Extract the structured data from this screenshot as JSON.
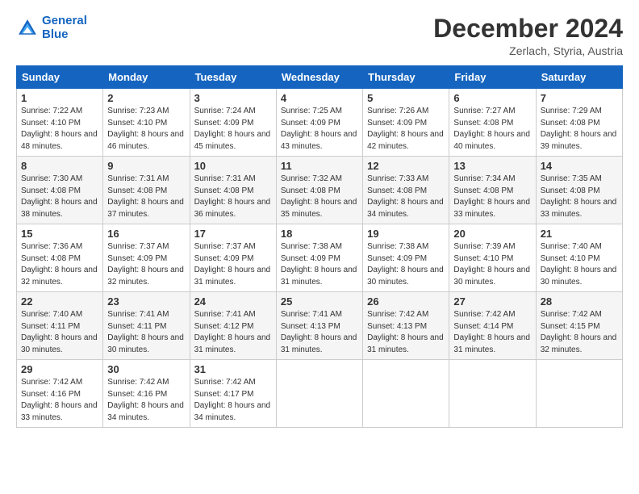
{
  "header": {
    "logo_line1": "General",
    "logo_line2": "Blue",
    "month_title": "December 2024",
    "location": "Zerlach, Styria, Austria"
  },
  "weekdays": [
    "Sunday",
    "Monday",
    "Tuesday",
    "Wednesday",
    "Thursday",
    "Friday",
    "Saturday"
  ],
  "rows": [
    [
      {
        "day": "1",
        "sunrise": "Sunrise: 7:22 AM",
        "sunset": "Sunset: 4:10 PM",
        "daylight": "Daylight: 8 hours and 48 minutes."
      },
      {
        "day": "2",
        "sunrise": "Sunrise: 7:23 AM",
        "sunset": "Sunset: 4:10 PM",
        "daylight": "Daylight: 8 hours and 46 minutes."
      },
      {
        "day": "3",
        "sunrise": "Sunrise: 7:24 AM",
        "sunset": "Sunset: 4:09 PM",
        "daylight": "Daylight: 8 hours and 45 minutes."
      },
      {
        "day": "4",
        "sunrise": "Sunrise: 7:25 AM",
        "sunset": "Sunset: 4:09 PM",
        "daylight": "Daylight: 8 hours and 43 minutes."
      },
      {
        "day": "5",
        "sunrise": "Sunrise: 7:26 AM",
        "sunset": "Sunset: 4:09 PM",
        "daylight": "Daylight: 8 hours and 42 minutes."
      },
      {
        "day": "6",
        "sunrise": "Sunrise: 7:27 AM",
        "sunset": "Sunset: 4:08 PM",
        "daylight": "Daylight: 8 hours and 40 minutes."
      },
      {
        "day": "7",
        "sunrise": "Sunrise: 7:29 AM",
        "sunset": "Sunset: 4:08 PM",
        "daylight": "Daylight: 8 hours and 39 minutes."
      }
    ],
    [
      {
        "day": "8",
        "sunrise": "Sunrise: 7:30 AM",
        "sunset": "Sunset: 4:08 PM",
        "daylight": "Daylight: 8 hours and 38 minutes."
      },
      {
        "day": "9",
        "sunrise": "Sunrise: 7:31 AM",
        "sunset": "Sunset: 4:08 PM",
        "daylight": "Daylight: 8 hours and 37 minutes."
      },
      {
        "day": "10",
        "sunrise": "Sunrise: 7:31 AM",
        "sunset": "Sunset: 4:08 PM",
        "daylight": "Daylight: 8 hours and 36 minutes."
      },
      {
        "day": "11",
        "sunrise": "Sunrise: 7:32 AM",
        "sunset": "Sunset: 4:08 PM",
        "daylight": "Daylight: 8 hours and 35 minutes."
      },
      {
        "day": "12",
        "sunrise": "Sunrise: 7:33 AM",
        "sunset": "Sunset: 4:08 PM",
        "daylight": "Daylight: 8 hours and 34 minutes."
      },
      {
        "day": "13",
        "sunrise": "Sunrise: 7:34 AM",
        "sunset": "Sunset: 4:08 PM",
        "daylight": "Daylight: 8 hours and 33 minutes."
      },
      {
        "day": "14",
        "sunrise": "Sunrise: 7:35 AM",
        "sunset": "Sunset: 4:08 PM",
        "daylight": "Daylight: 8 hours and 33 minutes."
      }
    ],
    [
      {
        "day": "15",
        "sunrise": "Sunrise: 7:36 AM",
        "sunset": "Sunset: 4:08 PM",
        "daylight": "Daylight: 8 hours and 32 minutes."
      },
      {
        "day": "16",
        "sunrise": "Sunrise: 7:37 AM",
        "sunset": "Sunset: 4:09 PM",
        "daylight": "Daylight: 8 hours and 32 minutes."
      },
      {
        "day": "17",
        "sunrise": "Sunrise: 7:37 AM",
        "sunset": "Sunset: 4:09 PM",
        "daylight": "Daylight: 8 hours and 31 minutes."
      },
      {
        "day": "18",
        "sunrise": "Sunrise: 7:38 AM",
        "sunset": "Sunset: 4:09 PM",
        "daylight": "Daylight: 8 hours and 31 minutes."
      },
      {
        "day": "19",
        "sunrise": "Sunrise: 7:38 AM",
        "sunset": "Sunset: 4:09 PM",
        "daylight": "Daylight: 8 hours and 30 minutes."
      },
      {
        "day": "20",
        "sunrise": "Sunrise: 7:39 AM",
        "sunset": "Sunset: 4:10 PM",
        "daylight": "Daylight: 8 hours and 30 minutes."
      },
      {
        "day": "21",
        "sunrise": "Sunrise: 7:40 AM",
        "sunset": "Sunset: 4:10 PM",
        "daylight": "Daylight: 8 hours and 30 minutes."
      }
    ],
    [
      {
        "day": "22",
        "sunrise": "Sunrise: 7:40 AM",
        "sunset": "Sunset: 4:11 PM",
        "daylight": "Daylight: 8 hours and 30 minutes."
      },
      {
        "day": "23",
        "sunrise": "Sunrise: 7:41 AM",
        "sunset": "Sunset: 4:11 PM",
        "daylight": "Daylight: 8 hours and 30 minutes."
      },
      {
        "day": "24",
        "sunrise": "Sunrise: 7:41 AM",
        "sunset": "Sunset: 4:12 PM",
        "daylight": "Daylight: 8 hours and 31 minutes."
      },
      {
        "day": "25",
        "sunrise": "Sunrise: 7:41 AM",
        "sunset": "Sunset: 4:13 PM",
        "daylight": "Daylight: 8 hours and 31 minutes."
      },
      {
        "day": "26",
        "sunrise": "Sunrise: 7:42 AM",
        "sunset": "Sunset: 4:13 PM",
        "daylight": "Daylight: 8 hours and 31 minutes."
      },
      {
        "day": "27",
        "sunrise": "Sunrise: 7:42 AM",
        "sunset": "Sunset: 4:14 PM",
        "daylight": "Daylight: 8 hours and 31 minutes."
      },
      {
        "day": "28",
        "sunrise": "Sunrise: 7:42 AM",
        "sunset": "Sunset: 4:15 PM",
        "daylight": "Daylight: 8 hours and 32 minutes."
      }
    ],
    [
      {
        "day": "29",
        "sunrise": "Sunrise: 7:42 AM",
        "sunset": "Sunset: 4:16 PM",
        "daylight": "Daylight: 8 hours and 33 minutes."
      },
      {
        "day": "30",
        "sunrise": "Sunrise: 7:42 AM",
        "sunset": "Sunset: 4:16 PM",
        "daylight": "Daylight: 8 hours and 34 minutes."
      },
      {
        "day": "31",
        "sunrise": "Sunrise: 7:42 AM",
        "sunset": "Sunset: 4:17 PM",
        "daylight": "Daylight: 8 hours and 34 minutes."
      },
      null,
      null,
      null,
      null
    ]
  ]
}
